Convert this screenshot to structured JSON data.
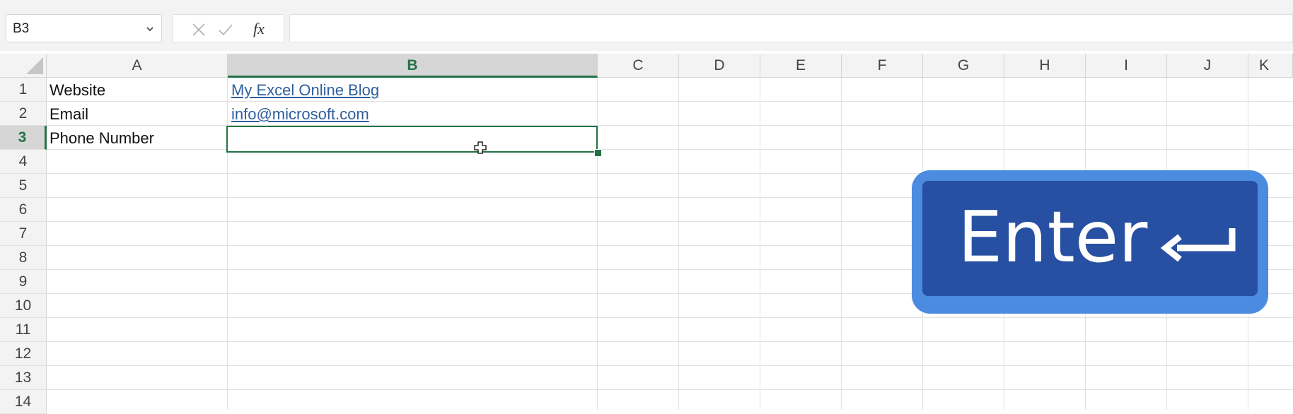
{
  "formula_bar": {
    "name_box": "B3",
    "cancel_icon": "close-icon",
    "enter_icon": "check-icon",
    "function_label": "fx",
    "formula_value": ""
  },
  "columns": [
    "A",
    "B",
    "C",
    "D",
    "E",
    "F",
    "G",
    "H",
    "I",
    "J",
    "K"
  ],
  "rows": [
    "1",
    "2",
    "3",
    "4",
    "5",
    "6",
    "7",
    "8",
    "9",
    "10",
    "11",
    "12",
    "13",
    "14"
  ],
  "selected_cell": "B3",
  "cells": {
    "A1": "Website",
    "B1": "My Excel Online Blog",
    "A2": "Email",
    "B2": "info@microsoft.com",
    "A3": "Phone Number"
  },
  "overlay": {
    "key_label": "Enter",
    "key_icon": "return-arrow-icon",
    "key_color": "#2750a3",
    "key_border_color": "#4b8be0"
  },
  "colors": {
    "accent": "#217346",
    "link": "#2f5f9e"
  }
}
